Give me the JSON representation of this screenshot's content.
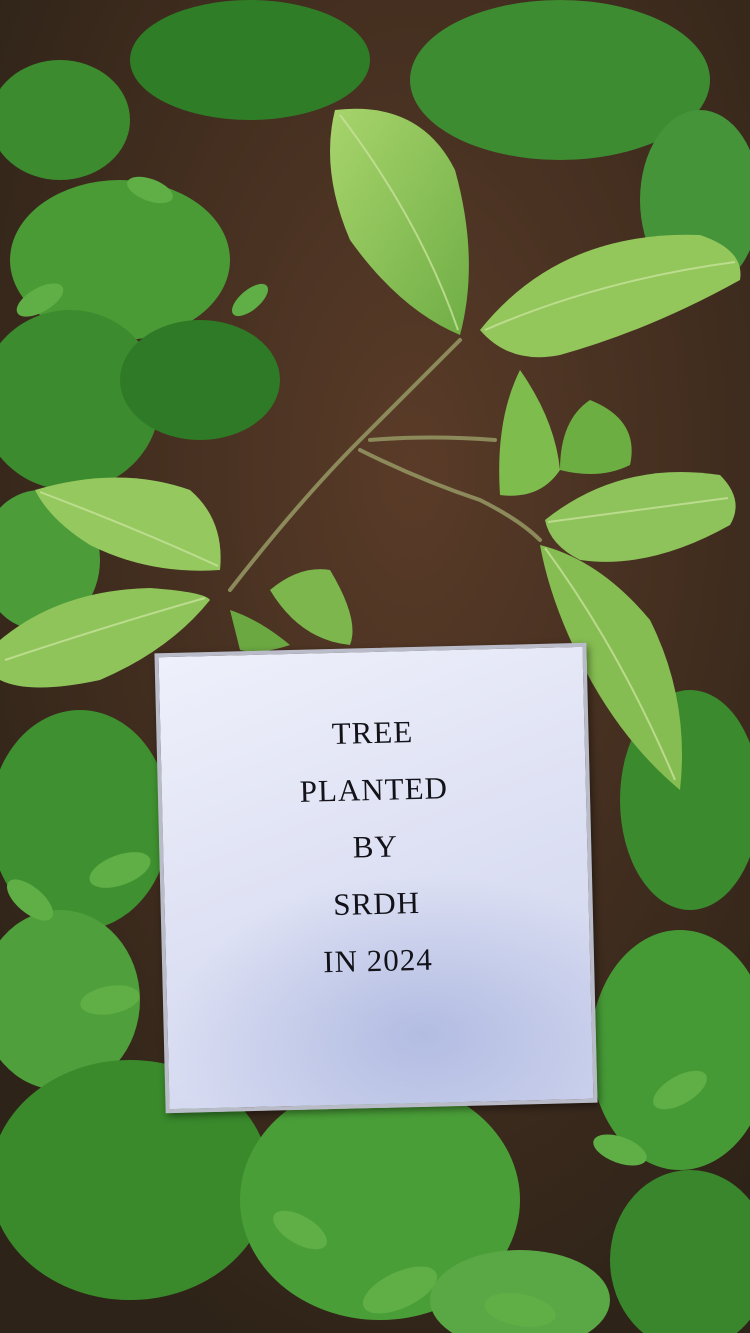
{
  "photo": {
    "subject": "sapling-with-sign",
    "colors": {
      "soil": "#3a2b1e",
      "leaf_light": "#8ec25a",
      "leaf_dark": "#3f8a2c",
      "sign_paper": "#e6e8f7"
    }
  },
  "sign": {
    "lines": [
      "TREE",
      "PLANTED",
      "BY",
      "SRDH",
      "IN 2024"
    ]
  }
}
